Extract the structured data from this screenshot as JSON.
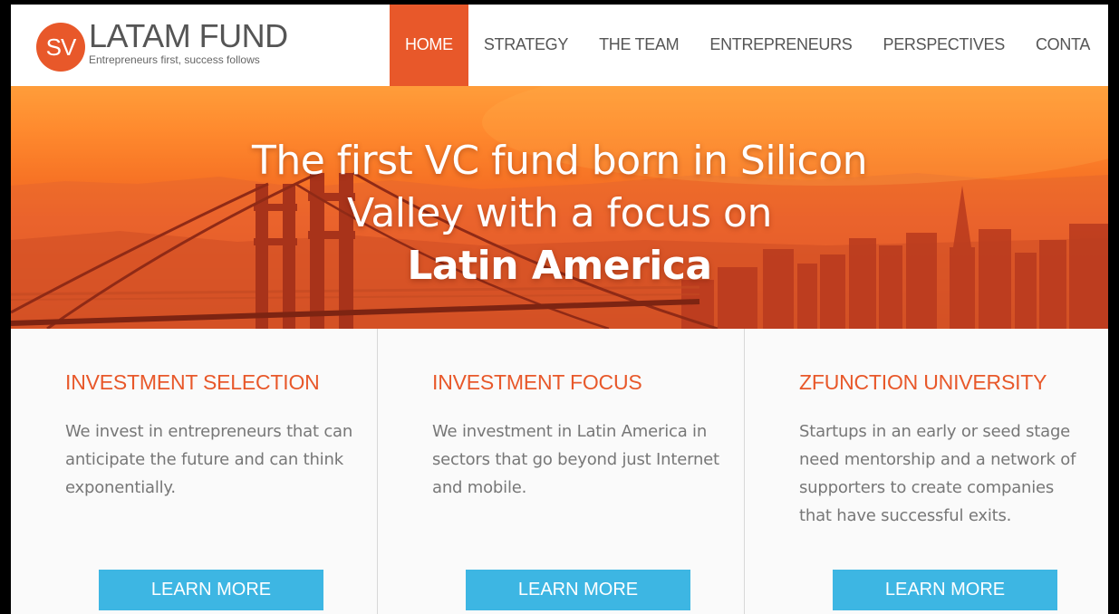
{
  "brand": {
    "logo_mark": "SV",
    "name": "LATAM FUND",
    "tagline": "Entrepreneurs first, success follows",
    "accent_color": "#e8582a"
  },
  "nav": {
    "items": [
      {
        "label": "HOME",
        "active": true
      },
      {
        "label": "STRATEGY",
        "active": false
      },
      {
        "label": "THE TEAM",
        "active": false
      },
      {
        "label": "ENTREPRENEURS",
        "active": false
      },
      {
        "label": "PERSPECTIVES",
        "active": false
      },
      {
        "label": "CONTA",
        "active": false
      }
    ]
  },
  "hero": {
    "line1": "The first VC fund born in Silicon",
    "line2": "Valley with a focus on",
    "line3": "Latin America"
  },
  "features": [
    {
      "title": "INVESTMENT SELECTION",
      "body": "We invest in entrepreneurs that can anticipate the future and can think exponentially.",
      "button": "LEARN MORE"
    },
    {
      "title": "INVESTMENT FOCUS",
      "body": "We investment in Latin America in sectors that go beyond just Internet and mobile.",
      "button": "LEARN MORE"
    },
    {
      "title": "ZFUNCTION UNIVERSITY",
      "body": "Startups in an early or seed stage need mentorship and a network of supporters to create companies that have successful exits.",
      "button": "LEARN MORE"
    }
  ],
  "colors": {
    "button": "#3db6e3",
    "heading": "#e8582a",
    "body_text": "#777777"
  }
}
